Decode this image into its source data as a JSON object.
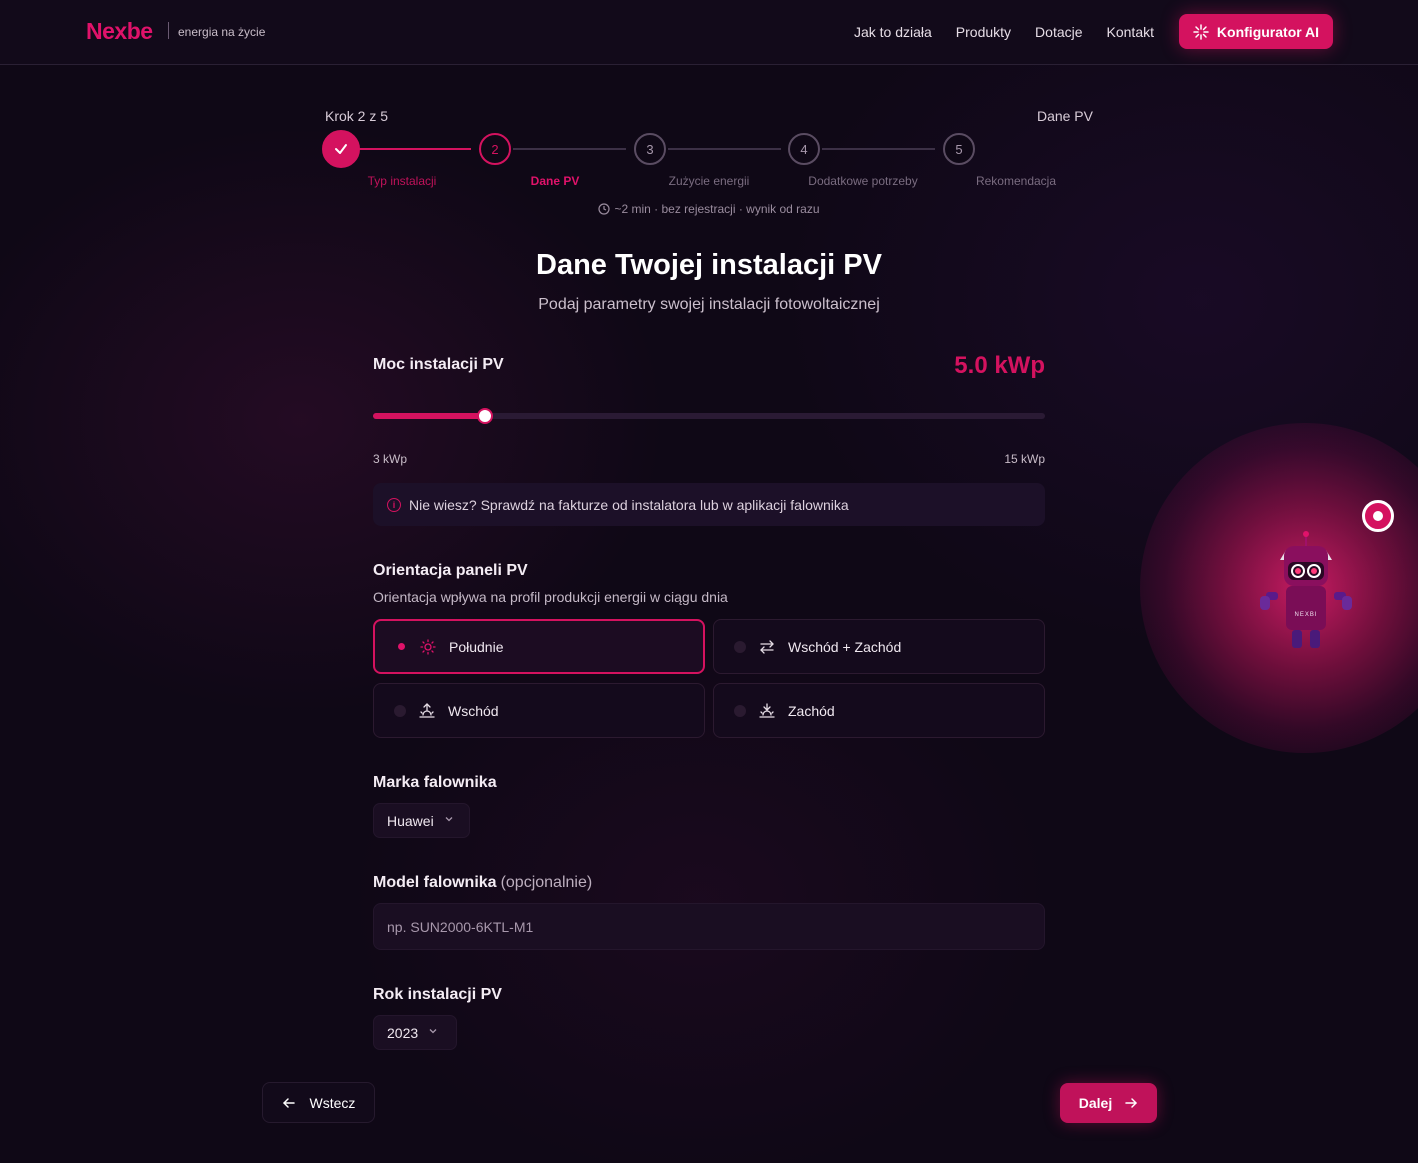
{
  "header": {
    "logo": "Nexbe",
    "tagline": "energia na życie",
    "nav": [
      "Jak to działa",
      "Produkty",
      "Dotacje",
      "Kontakt"
    ],
    "cta_label": "Konfigurator AI"
  },
  "stepper": {
    "progress_text": "Krok 2 z 5",
    "current_step_name": "Dane PV",
    "steps": [
      {
        "number": "1",
        "label": "Typ instalacji",
        "state": "done"
      },
      {
        "number": "2",
        "label": "Dane PV",
        "state": "active"
      },
      {
        "number": "3",
        "label": "Zużycie energii",
        "state": "todo"
      },
      {
        "number": "4",
        "label": "Dodatkowe potrzeby",
        "state": "todo"
      },
      {
        "number": "5",
        "label": "Rekomendacja",
        "state": "todo"
      }
    ],
    "time_note": "~2 min · bez rejestracji · wynik od razu"
  },
  "page": {
    "title": "Dane Twojej instalacji PV",
    "subtitle": "Podaj parametry swojej instalacji fotowoltaicznej"
  },
  "power": {
    "label": "Moc instalacji PV",
    "value_text": "5.0 kWp",
    "value": 5.0,
    "min": 3,
    "max": 15,
    "min_label": "3 kWp",
    "max_label": "15 kWp",
    "hint": "Nie wiesz? Sprawdź na fakturze od instalatora lub w aplikacji falownika"
  },
  "orientation": {
    "label": "Orientacja paneli PV",
    "description": "Orientacja wpływa na profil produkcji energii w ciągu dnia",
    "options": [
      {
        "label": "Południe",
        "icon": "sun-icon",
        "selected": true
      },
      {
        "label": "Wschód + Zachód",
        "icon": "arrows-swap-icon",
        "selected": false
      },
      {
        "label": "Wschód",
        "icon": "sunrise-icon",
        "selected": false
      },
      {
        "label": "Zachód",
        "icon": "sunset-icon",
        "selected": false
      }
    ]
  },
  "inverter_brand": {
    "label": "Marka falownika",
    "selected": "Huawei"
  },
  "inverter_model": {
    "label": "Model falownika",
    "optional_note": "(opcjonalnie)",
    "value": "",
    "placeholder": "np. SUN2000-6KTL-M1"
  },
  "install_year": {
    "label": "Rok instalacji PV",
    "selected": "2023"
  },
  "actions": {
    "back_label": "Wstecz",
    "next_label": "Dalej"
  },
  "assistant": {
    "badge": "NEXBI"
  },
  "colors": {
    "accent": "#d4125f",
    "background": "#0f0816"
  }
}
